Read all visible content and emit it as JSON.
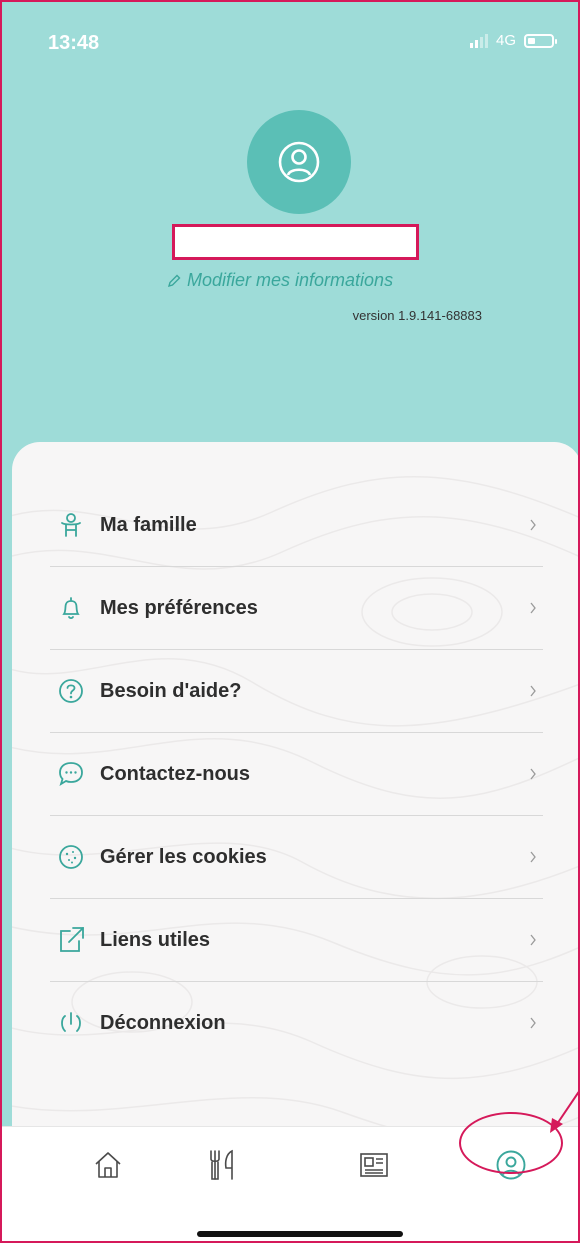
{
  "status_bar": {
    "time": "13:48",
    "network": "4G"
  },
  "profile": {
    "edit_link": "Modifier mes informations",
    "version": "version 1.9.141-68883"
  },
  "menu": {
    "items": [
      {
        "label": "Ma famille",
        "icon": "family-icon"
      },
      {
        "label": "Mes préférences",
        "icon": "bell-icon"
      },
      {
        "label": "Besoin d'aide?",
        "icon": "question-icon"
      },
      {
        "label": "Contactez-nous",
        "icon": "chat-icon"
      },
      {
        "label": "Gérer les cookies",
        "icon": "cookie-icon"
      },
      {
        "label": "Liens utiles",
        "icon": "external-link-icon"
      },
      {
        "label": "Déconnexion",
        "icon": "power-icon"
      }
    ]
  },
  "tabbar": {
    "tabs": [
      {
        "icon": "home-icon"
      },
      {
        "icon": "restaurant-icon"
      },
      {
        "icon": "news-icon"
      },
      {
        "icon": "profile-icon",
        "selected": true
      }
    ]
  },
  "colors": {
    "accent": "#5bbfb6",
    "header_bg": "#9edcd8",
    "highlight": "#d5195a"
  }
}
